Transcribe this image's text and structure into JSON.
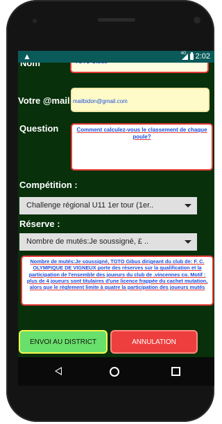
{
  "status_bar": {
    "warning_icon": "▲",
    "network_label": "4G",
    "time": "2:02"
  },
  "form": {
    "nom": {
      "label": "Nom",
      "value": "TOTO Gibus"
    },
    "email": {
      "label": "Votre @mail:",
      "value": "mailbidon@gmail.com"
    },
    "question": {
      "label": "Question",
      "value": "Comment calculez-vous le classement de chaque poule?"
    },
    "competition": {
      "label": "Compétition :",
      "selected": "Challenge régional U11 1er tour (1er.."
    },
    "reserve": {
      "label": "Réserve :",
      "selected": "Nombre de mutés:Je soussigné, £ ..",
      "text": "Nombre de mutés:Je soussigné, TOTO Gibus dirigeant du club de: F. C. OLYMPIQUE DE VIGNEUX porte des réserves sur la qualification et la participation de l'ensemble des joueurs du club de .vincennes co. Motif : plus de 4 joueurs sont titulaires d'une licence frappée du cachet mutation, alors que le règlement limite à quatre la participation des joueurs mutés"
    }
  },
  "buttons": {
    "send": "ENVOI AU DISTRICT",
    "cancel": "ANNULATION"
  },
  "nav": [
    "back-icon",
    "home-icon",
    "recents-icon"
  ]
}
